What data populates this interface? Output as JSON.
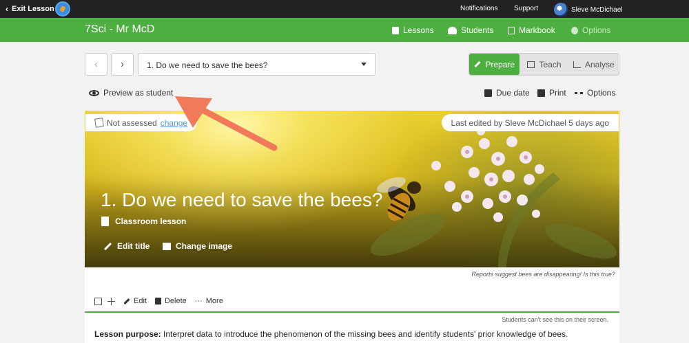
{
  "topbar": {
    "exit_label": "Exit Lesson",
    "notifications": "Notifications",
    "support": "Support",
    "user_name": "Sleve McDichael"
  },
  "classbar": {
    "title": "7Sci - Mr McD",
    "nav": {
      "lessons": "Lessons",
      "students": "Students",
      "markbook": "Markbook",
      "options": "Options"
    }
  },
  "controls": {
    "prev_icon": "‹",
    "next_icon": "›",
    "lesson_select_value": "1. Do we need to save the bees?",
    "modes": {
      "prepare": "Prepare",
      "teach": "Teach",
      "analyse": "Analyse"
    },
    "active_mode": "prepare"
  },
  "actions": {
    "preview": "Preview as student",
    "due_date": "Due date",
    "print": "Print",
    "options": "Options"
  },
  "hero": {
    "assessment_status": "Not assessed",
    "assessment_link": "change",
    "last_edited": "Last edited by Sleve McDichael 5 days ago",
    "title": "1. Do we need to save the bees?",
    "lesson_type": "Classroom lesson",
    "edit_title": "Edit title",
    "change_image": "Change image"
  },
  "content": {
    "image_caption": "Reports suggest bees are disappearing! Is this true?",
    "toolbar": {
      "edit": "Edit",
      "delete": "Delete",
      "more": "More"
    },
    "student_notice": "Students can't see this on their screen.",
    "purpose_label": "Lesson purpose:",
    "purpose_text": " Interpret data to introduce the phenomenon of the missing bees and identify students' prior knowledge of bees."
  },
  "colors": {
    "brand_green": "#4caf3f",
    "topbar": "#222222",
    "annotation_arrow": "#f07a5a",
    "link": "#5b9fd6"
  },
  "icons": [
    "chevron-left-icon",
    "app-logo-icon",
    "globe-avatar-icon",
    "document-icon",
    "people-icon",
    "grid-icon",
    "gear-icon",
    "pencil-icon",
    "presentation-icon",
    "chart-icon",
    "eye-icon",
    "calendar-icon",
    "printer-icon",
    "dots-icon",
    "no-grade-icon",
    "image-icon",
    "checkbox-icon",
    "move-icon",
    "trash-icon"
  ]
}
